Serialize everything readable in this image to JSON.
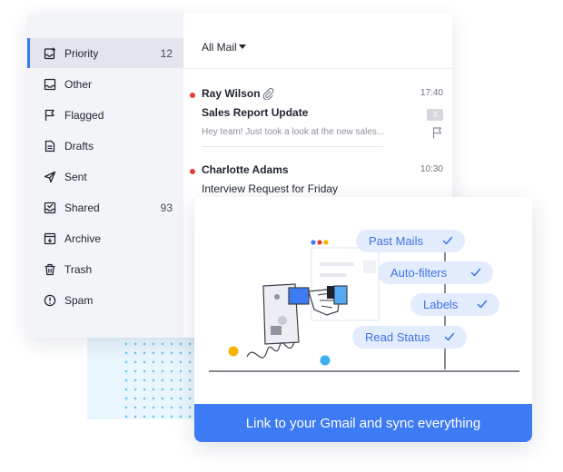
{
  "sidebar": {
    "items": [
      {
        "label": "Priority",
        "count": "12",
        "icon": "priority-icon",
        "active": true
      },
      {
        "label": "Other",
        "count": "",
        "icon": "inbox-icon"
      },
      {
        "label": "Flagged",
        "count": "",
        "icon": "flag-icon"
      },
      {
        "label": "Drafts",
        "count": "",
        "icon": "draft-icon"
      },
      {
        "label": "Sent",
        "count": "",
        "icon": "send-icon"
      },
      {
        "label": "Shared",
        "count": "93",
        "icon": "shared-icon"
      },
      {
        "label": "Archive",
        "count": "",
        "icon": "archive-icon"
      },
      {
        "label": "Trash",
        "count": "",
        "icon": "trash-icon"
      },
      {
        "label": "Spam",
        "count": "",
        "icon": "spam-icon"
      }
    ]
  },
  "mail_list": {
    "filter_label": "All Mail",
    "messages": [
      {
        "sender": "Ray Wilson",
        "time": "17:40",
        "subject": "Sales Report Update",
        "preview": "Hey team! Just took a look at the new sales...",
        "badge": "3",
        "unread": true,
        "has_attachment": true,
        "flagged": true
      },
      {
        "sender": "Charlotte Adams",
        "time": "10:30",
        "subject": "Interview Request for Friday",
        "unread": true
      }
    ]
  },
  "feature_card": {
    "features": [
      {
        "label": "Past Mails"
      },
      {
        "label": "Auto-filters"
      },
      {
        "label": "Labels"
      },
      {
        "label": "Read Status"
      }
    ],
    "cta_label": "Link to your Gmail and sync everything"
  },
  "colors": {
    "accent": "#3d7bf4",
    "unread_dot": "#ea3a3a",
    "pill_bg": "#e2ecfc",
    "pill_text": "#3d72e6"
  }
}
